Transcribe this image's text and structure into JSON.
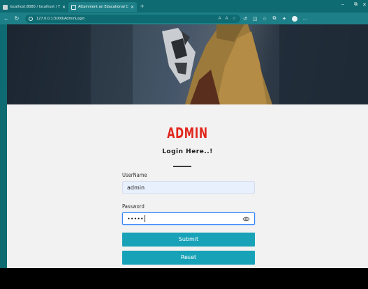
{
  "browser": {
    "tabs": [
      {
        "title": "localhost:8080 / localhost / This",
        "active": false
      },
      {
        "title": "Attainment an Educational Cente",
        "active": true
      }
    ],
    "url": "127.0.0.1:5000/AdminLogin",
    "accent": "#0f6b72"
  },
  "login": {
    "heading": "ADMIN",
    "subtitle": "Login Here..!",
    "username_label": "UserName",
    "username_value": "admin",
    "password_label": "Password",
    "password_mask": "•••••",
    "submit_label": "Submit",
    "reset_label": "Reset",
    "heading_color": "#e1251b",
    "button_color": "#17a2b8"
  }
}
